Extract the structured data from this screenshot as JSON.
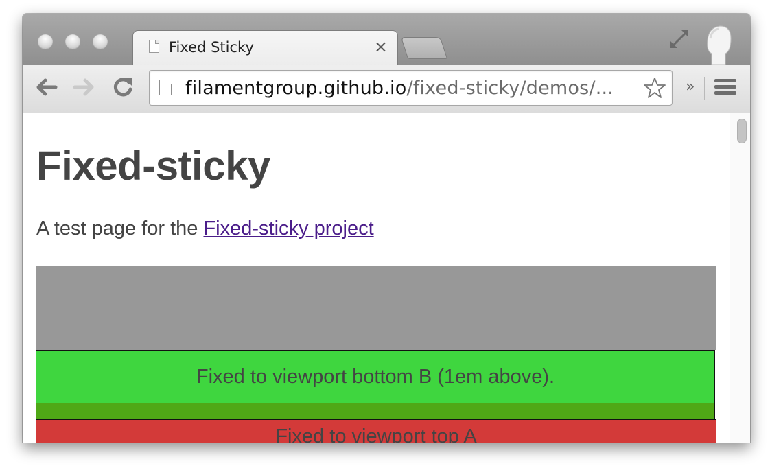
{
  "tab": {
    "title": "Fixed Sticky",
    "close_glyph": "×"
  },
  "address_bar": {
    "url_host": "filamentgroup.github.io",
    "url_path": "/fixed-sticky/demos/..."
  },
  "toolbar": {
    "overflow_glyph": "»"
  },
  "page": {
    "title": "Fixed-sticky",
    "intro_text": "A test page for the ",
    "intro_link": "Fixed-sticky project",
    "green_bar_text": "Fixed to viewport bottom B (1em above).",
    "red_bar_text": "Fixed to viewport top A"
  },
  "colors": {
    "gray_box": "#989898",
    "green_bar": "#3fd63f",
    "dark_green_bar": "#4fa816",
    "red_bar": "#d33a39",
    "link": "#4b1d8a"
  }
}
